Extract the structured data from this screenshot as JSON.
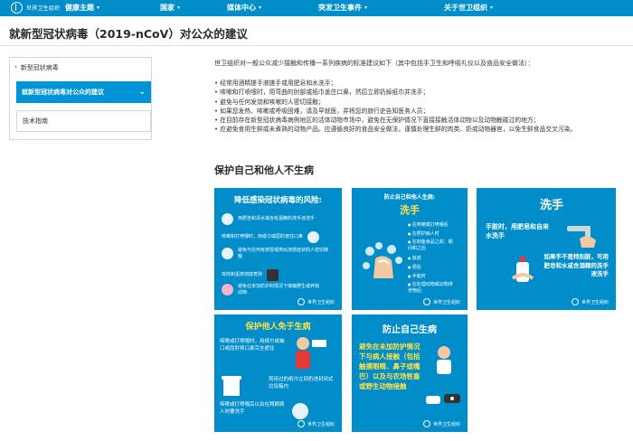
{
  "nav": {
    "logo_text": "世界卫生组织",
    "items": [
      {
        "label": "健康主题"
      },
      {
        "label": "国家"
      },
      {
        "label": "媒体中心"
      },
      {
        "label": "突发卫生事件"
      },
      {
        "label": "关于世卫组织"
      }
    ]
  },
  "page": {
    "title": "就新型冠状病毒（2019-nCoV）对公众的建议"
  },
  "sidebar": {
    "back_label": "新型冠状病毒",
    "active_label": "就新型冠状病毒对公众的建议",
    "item_label": "技术指南"
  },
  "content": {
    "intro": "世卫组织对一般公众减少接触和传播一系列疾病的标准建议如下（其中包括手卫生和呼吸礼仪以及食品安全做法）：",
    "bullets": [
      "经常用酒精搓手液搓手或用肥皂和水洗手；",
      "咳嗽和打喷嚏时，用弯曲的肘部或纸巾盖住口鼻，然后立即扔掉纸巾并洗手；",
      "避免与任何发烧和咳嗽的人密切接触；",
      "如果您发热、咳嗽或呼吸困难，请及早就医，并将您的旅行史告知医务人员；",
      "在目前存在新型冠状病毒病例地区的活体动物市场中，避免在无保护情况下直接接触活体动物以及动物触碰过的地方；",
      "应避免食用生鲜或未煮熟的动物产品。应遵循良好的食品安全做法，谨慎处理生鲜的肉类、奶或动物器官，以免生鲜食品交叉污染。"
    ],
    "section_title": "保护自己和他人不生病"
  },
  "cards": {
    "who_label": "世界卫生组织",
    "card1": {
      "title": "降低感染冠状病毒的风险:",
      "rows": [
        "用肥皂和清水或含有酒精的洗手液洗手",
        "咳嗽和打喷嚏时，用纸巾或屈肘遮住口鼻",
        "避免与任何有感冒或类似流感症状的人密切接触",
        "将肉和蛋类彻底煮熟",
        "避免在未加防护的情况下接触野生或养殖动物"
      ]
    },
    "card2": {
      "tag": "防止自己和他人生病:",
      "wash": "洗手",
      "list": [
        "在咳嗽或打喷嚏后",
        "在照护病人时",
        "在制备食品之前、期间和之后",
        "饭前",
        "便后",
        "手脏时",
        "在处理动物或动物排泄物后"
      ]
    },
    "card3": {
      "title": "洗手",
      "line1": "手脏时，用肥皂和自来水洗手",
      "line2": "如果手不是特别脏，可用肥皂和水或含酒精的洗手液洗手"
    },
    "card4": {
      "title": "保护他人免于生病",
      "row1": "咳嗽或打喷嚏时，用纸巾或袖口或屈肘将口鼻完全遮住",
      "row2": "将用过的纸巾立刻扔进封闭式垃圾箱内",
      "row3": "咳嗽或打喷嚏后以及在照顾病人时要洗手"
    },
    "card5": {
      "title": "防止自己生病",
      "text": "避免在未加防护情况下与病人接触（包括触摸眼睛、鼻子或嘴巴）以及与农场牲畜或野生动物接触"
    }
  }
}
